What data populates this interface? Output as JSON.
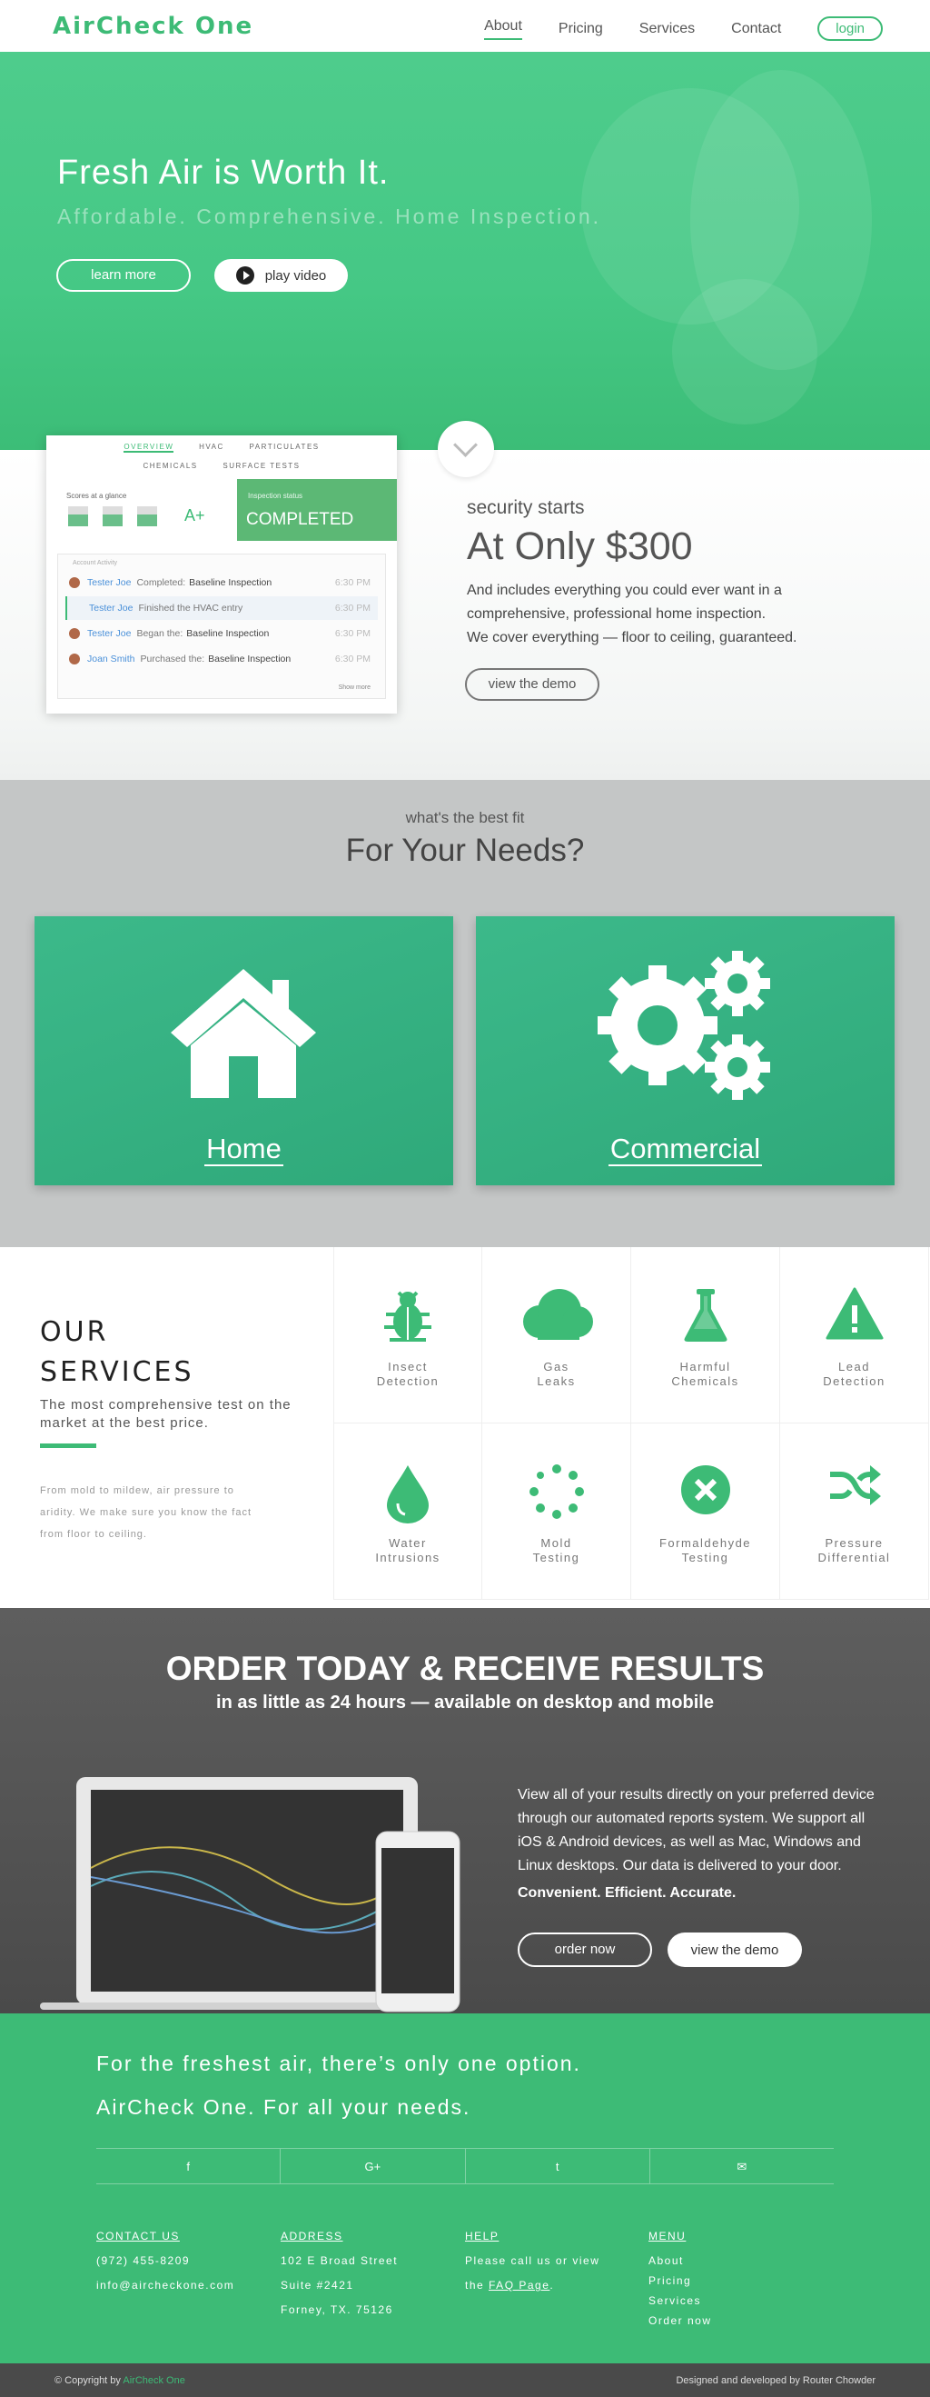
{
  "nav": {
    "logo": "AirCheck One",
    "links": [
      "About",
      "Pricing",
      "Services",
      "Contact"
    ],
    "login": "login"
  },
  "hero": {
    "title": "Fresh Air is Worth It.",
    "subtitle": "Affordable. Comprehensive. Home Inspection.",
    "learn_more": "learn more",
    "play_video": "play video"
  },
  "dashboard": {
    "tabs": [
      "OVERVIEW",
      "HVAC",
      "PARTICULATES",
      "CHEMICALS",
      "SURFACE TESTS"
    ],
    "scores_label": "Scores at a glance",
    "score_labels": [
      "HVAC",
      "PARTIC.",
      "CHEM.",
      "OVERALL"
    ],
    "grade": "A+",
    "inspection_label": "Inspection status",
    "inspection_value": "COMPLETED",
    "activity_label": "Account Activity",
    "activity": [
      {
        "name": "Tester Joe",
        "action": "Completed:",
        "item": "Baseline Inspection",
        "time": "6:30 PM"
      },
      {
        "name": "Tester Joe",
        "action": "Finished the HVAC entry",
        "item": "",
        "time": "6:30 PM"
      },
      {
        "name": "Tester Joe",
        "action": "Began the:",
        "item": "Baseline Inspection",
        "time": "6:30 PM"
      },
      {
        "name": "Joan Smith",
        "action": "Purchased the:",
        "item": "Baseline Inspection",
        "time": "6:30 PM"
      }
    ],
    "show_more": "Show more"
  },
  "pricing": {
    "kicker": "security starts",
    "headline": "At Only $300",
    "lines": [
      "And includes everything you could ever want in a",
      "comprehensive, professional home inspection.",
      "We cover everything — floor to ceiling, guaranteed."
    ],
    "cta": "view the demo"
  },
  "fit": {
    "kicker": "what's the best fit",
    "headline": "For Your Needs?",
    "home": "Home",
    "commercial": "Commercial"
  },
  "services": {
    "title1": "OUR",
    "title2": "SERVICES",
    "subtitle": "The most comprehensive test on the market at the best price.",
    "small": "From mold to mildew, air pressure to aridity. We make sure you know the fact from floor to ceiling.",
    "items": [
      [
        "Insect",
        "Detection"
      ],
      [
        "Gas",
        "Leaks"
      ],
      [
        "Harmful",
        "Chemicals"
      ],
      [
        "Lead",
        "Detection"
      ],
      [
        "Water",
        "Intrusions"
      ],
      [
        "Mold",
        "Testing"
      ],
      [
        "Formaldehyde",
        "Testing"
      ],
      [
        "Pressure",
        "Differential"
      ]
    ]
  },
  "order": {
    "title": "ORDER TODAY & RECEIVE RESULTS",
    "subtitle": "in as little as 24 hours — available on desktop and mobile",
    "body": "View all of your results directly on your preferred device through our automated reports system. We support all iOS & Android devices, as well as Mac, Windows and Linux desktops. Our data is delivered to your door.",
    "tagline": "Convenient. Efficient. Accurate.",
    "order_now": "order now",
    "view_demo": "view the demo"
  },
  "footer": {
    "line1": "For the freshest air, there’s only one option.",
    "line2": "AirCheck One. For all your needs.",
    "social": [
      "f",
      "G+",
      "t",
      "✉"
    ],
    "contact_h": "CONTACT US",
    "phone": "(972) 455-8209",
    "email": "info@aircheckone.com",
    "address_h": "ADDRESS",
    "addr1": "102 E Broad Street",
    "addr2": "Suite #2421",
    "addr3": "Forney, TX. 75126",
    "help_h": "HELP",
    "help1": "Please call us or view",
    "help2a": "the ",
    "help2b": "FAQ Page",
    "help2c": ".",
    "menu_h": "MENU",
    "menu": [
      "About",
      "Pricing",
      "Services",
      "Order now"
    ]
  },
  "bottom": {
    "copy": "© Copyright by ",
    "brand": "AirCheck One",
    "credit": "Designed and developed by Router Chowder"
  },
  "colors": {
    "accent": "#3dbb76",
    "dark": "#4a4a4a"
  }
}
